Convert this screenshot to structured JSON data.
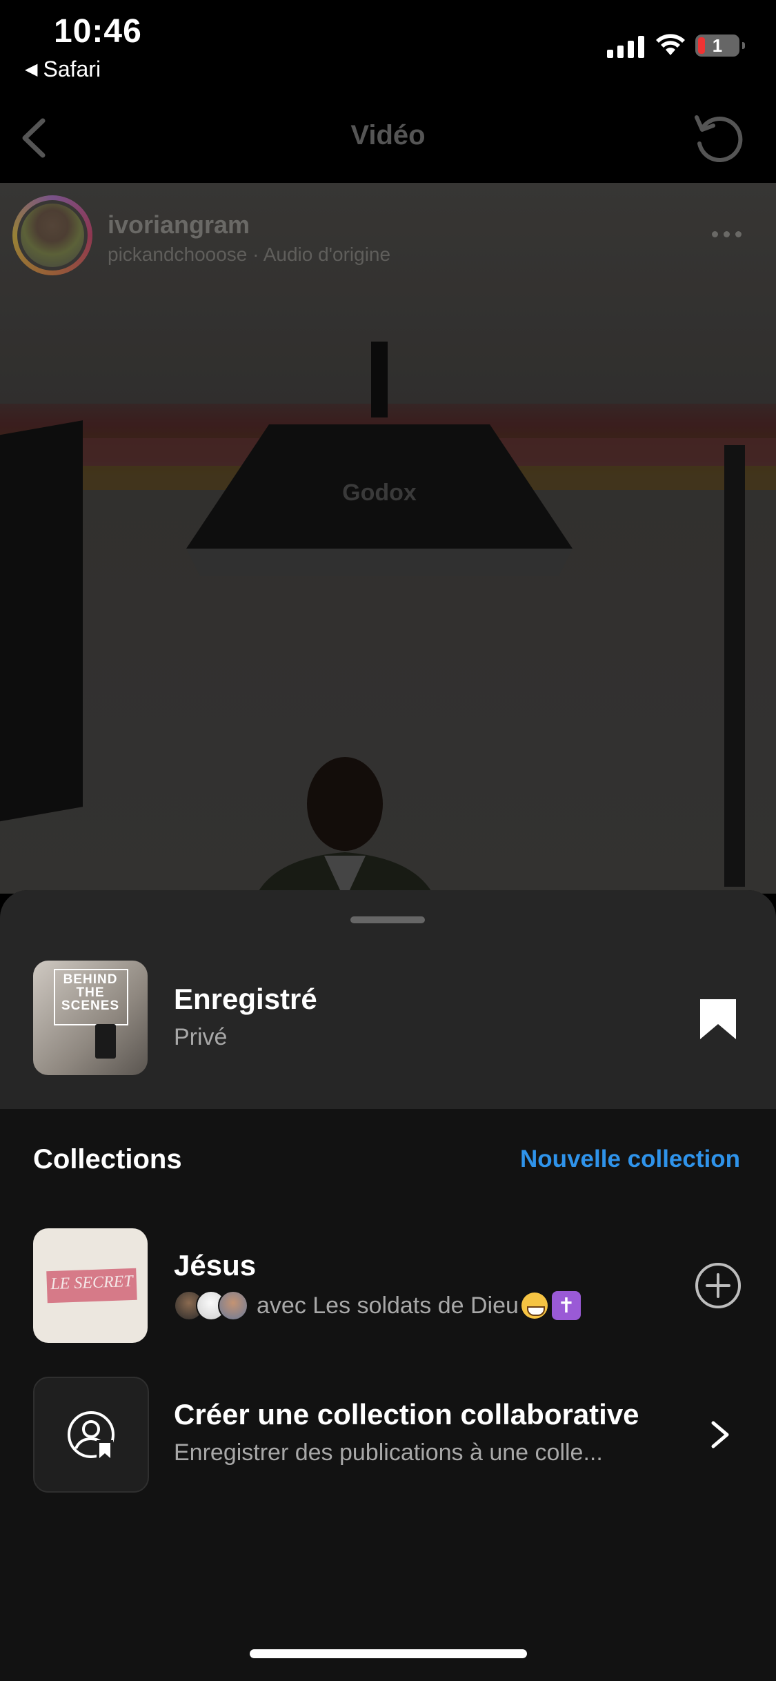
{
  "status_bar": {
    "time": "10:46",
    "back_app": "Safari",
    "battery_level": "1",
    "icons": [
      "cellular-signal-icon",
      "wifi-icon",
      "battery-icon"
    ]
  },
  "nav": {
    "title": "Vidéo",
    "icons": [
      "chevron-left-icon",
      "refresh-icon"
    ]
  },
  "post": {
    "username": "ivoriangram",
    "audio": "pickandchooose · Audio d'origine",
    "thumbnail_text": "Godox"
  },
  "saved": {
    "title": "Enregistré",
    "subtitle": "Privé",
    "thumbnail_text": "BEHIND THE SCENES",
    "icon": "bookmark-filled-icon"
  },
  "collections": {
    "header": "Collections",
    "new_label": "Nouvelle collection",
    "items": [
      {
        "title": "Jésus",
        "subtitle": "avec Les soldats de Dieu",
        "thumbnail_text": "LE SECRET",
        "action_icon": "plus-circle-icon"
      }
    ],
    "collab": {
      "title": "Créer une collection collaborative",
      "subtitle": "Enregistrer des publications à une colle...",
      "icon": "collab-user-bookmark-icon"
    }
  },
  "colors": {
    "accent": "#2f93ea",
    "sheet_top": "#262626",
    "sheet_bg": "#121212"
  }
}
